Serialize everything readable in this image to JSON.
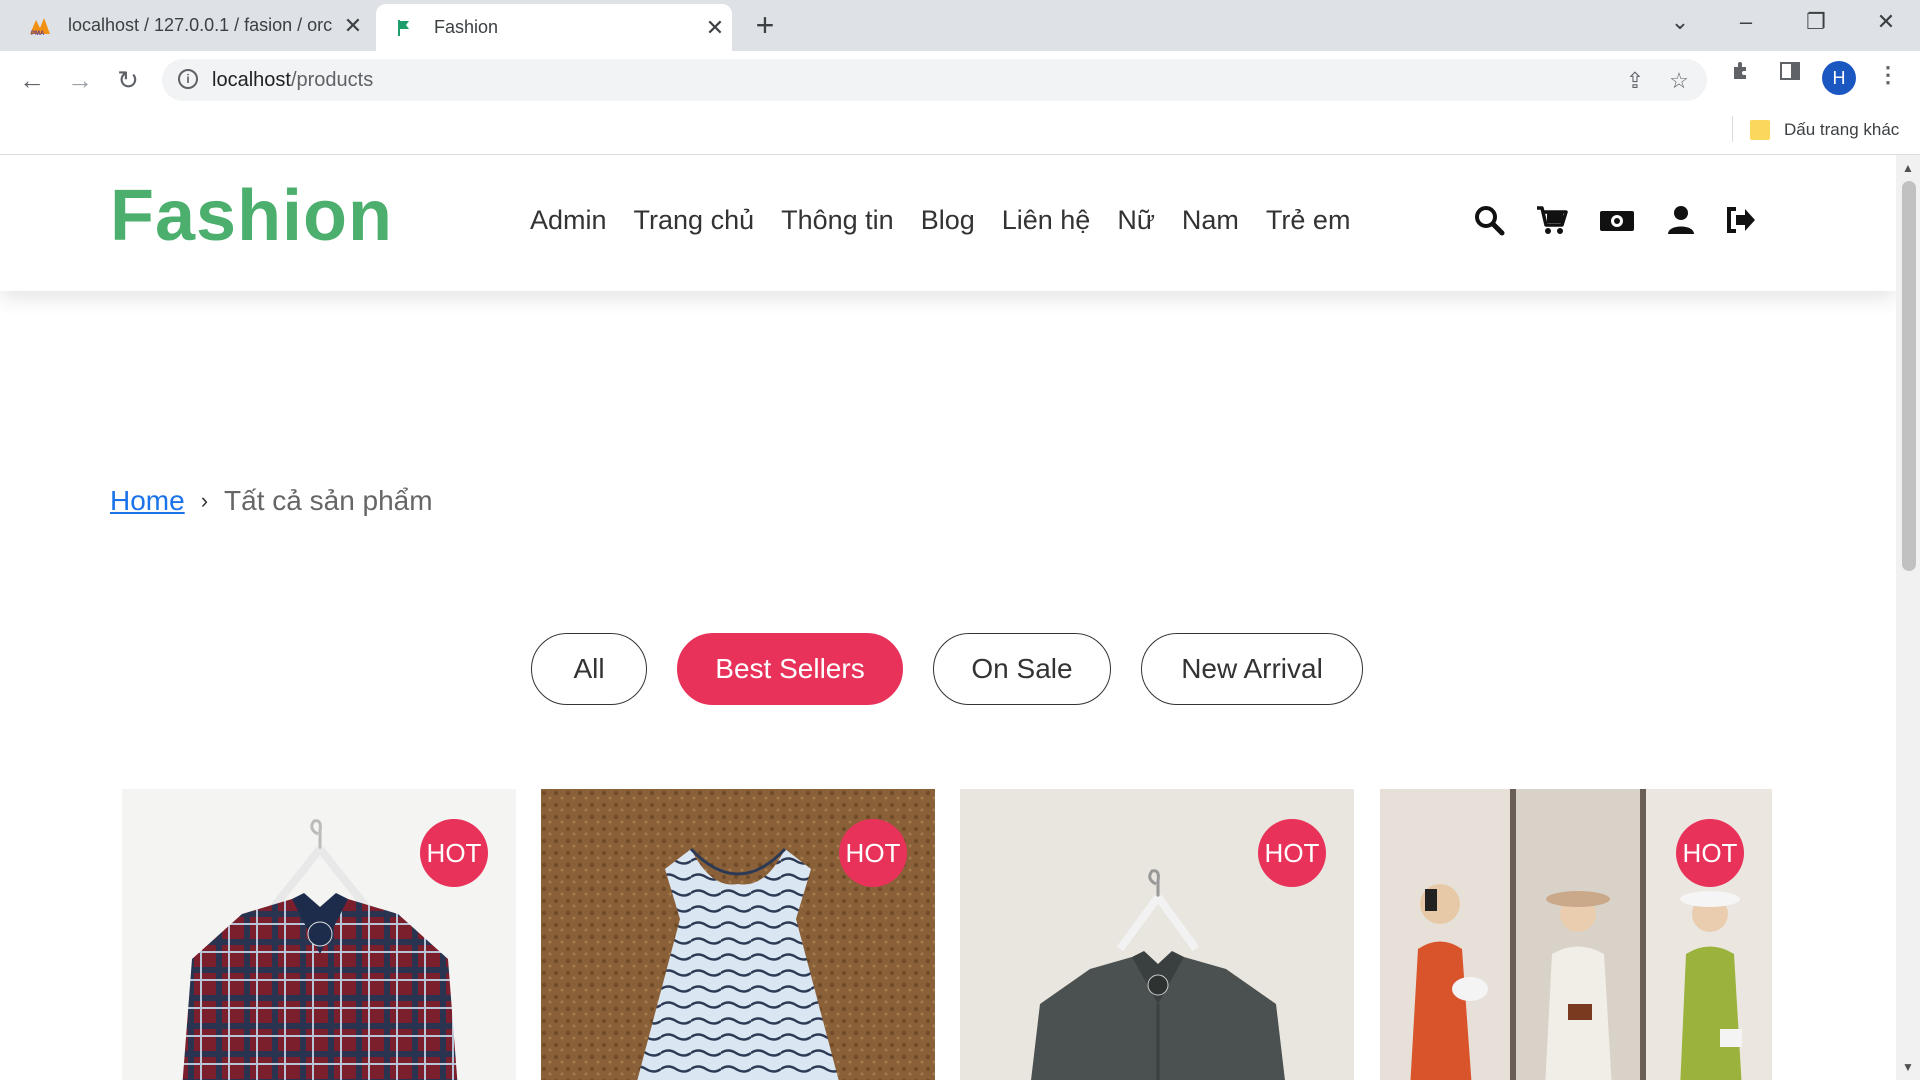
{
  "browser": {
    "tabs": [
      {
        "title": "localhost / 127.0.0.1 / fasion / orc",
        "active": false
      },
      {
        "title": "Fashion",
        "active": true
      }
    ],
    "url_host": "localhost",
    "url_path": "/products",
    "profile_initial": "H",
    "bookmark_folder": "Dấu trang khác"
  },
  "site": {
    "logo": "Fashion",
    "brand_color": "#4caf6e",
    "accent_color": "#e8325a",
    "nav": [
      "Admin",
      "Trang chủ",
      "Thông tin",
      "Blog",
      "Liên hệ",
      "Nữ",
      "Nam",
      "Trẻ em"
    ],
    "header_icons": [
      "search-icon",
      "cart-icon",
      "money-icon",
      "user-icon",
      "logout-icon"
    ]
  },
  "breadcrumb": {
    "home": "Home",
    "current": "Tất cả sản phẩm"
  },
  "filters": [
    {
      "label": "All",
      "active": false
    },
    {
      "label": "Best Sellers",
      "active": true
    },
    {
      "label": "On Sale",
      "active": false
    },
    {
      "label": "New Arrival",
      "active": false
    }
  ],
  "products": [
    {
      "badge": "HOT",
      "image": "red plaid shirt on hanger"
    },
    {
      "badge": "HOT",
      "image": "striped kids dress on cork"
    },
    {
      "badge": "HOT",
      "image": "dark grey shirt on hanger"
    },
    {
      "badge": "HOT",
      "image": "three women mirror selfie"
    }
  ]
}
